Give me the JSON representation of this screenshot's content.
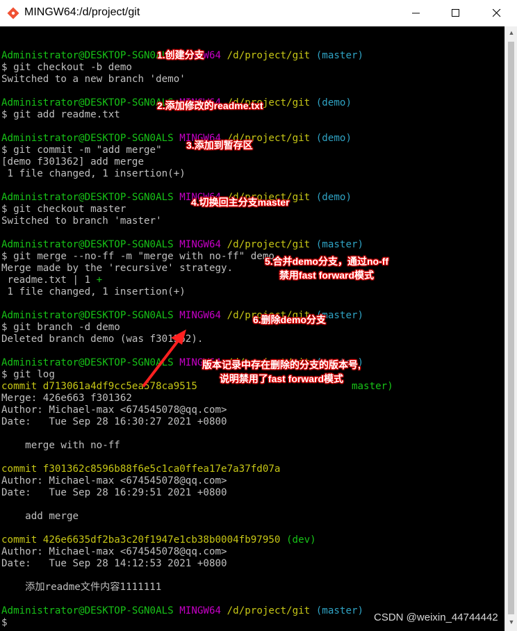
{
  "window": {
    "title": "MINGW64:/d/project/git"
  },
  "prompt": {
    "user_host": "Administrator@DESKTOP-SGN0ALS",
    "shell": "MINGW64",
    "path": "/d/project/git"
  },
  "lines": [
    {
      "segs": []
    },
    {
      "segs": [
        {
          "t": "Administrator@DESKTOP-SGN0ALS",
          "c": "user"
        },
        {
          "t": " "
        },
        {
          "t": "MINGW64",
          "c": "host"
        },
        {
          "t": " "
        },
        {
          "t": "/d/project/git",
          "c": "path"
        },
        {
          "t": " "
        },
        {
          "t": "(master)",
          "c": "branch"
        }
      ]
    },
    {
      "segs": [
        {
          "t": "$ git checkout -b demo"
        }
      ]
    },
    {
      "segs": [
        {
          "t": "Switched to a new branch 'demo'"
        }
      ]
    },
    {
      "segs": []
    },
    {
      "segs": [
        {
          "t": "Administrator@DESKTOP-SGN0ALS",
          "c": "user"
        },
        {
          "t": " "
        },
        {
          "t": "MINGW64",
          "c": "host"
        },
        {
          "t": " "
        },
        {
          "t": "/d/project/git",
          "c": "path"
        },
        {
          "t": " "
        },
        {
          "t": "(demo)",
          "c": "branch"
        }
      ]
    },
    {
      "segs": [
        {
          "t": "$ git add readme.txt"
        }
      ]
    },
    {
      "segs": []
    },
    {
      "segs": [
        {
          "t": "Administrator@DESKTOP-SGN0ALS",
          "c": "user"
        },
        {
          "t": " "
        },
        {
          "t": "MINGW64",
          "c": "host"
        },
        {
          "t": " "
        },
        {
          "t": "/d/project/git",
          "c": "path"
        },
        {
          "t": " "
        },
        {
          "t": "(demo)",
          "c": "branch"
        }
      ]
    },
    {
      "segs": [
        {
          "t": "$ git commit -m \"add merge\""
        }
      ]
    },
    {
      "segs": [
        {
          "t": "[demo f301362] add merge"
        }
      ]
    },
    {
      "segs": [
        {
          "t": " 1 file changed, 1 insertion(+)"
        }
      ]
    },
    {
      "segs": []
    },
    {
      "segs": [
        {
          "t": "Administrator@DESKTOP-SGN0ALS",
          "c": "user"
        },
        {
          "t": " "
        },
        {
          "t": "MINGW64",
          "c": "host"
        },
        {
          "t": " "
        },
        {
          "t": "/d/project/git",
          "c": "path"
        },
        {
          "t": " "
        },
        {
          "t": "(demo)",
          "c": "branch"
        }
      ]
    },
    {
      "segs": [
        {
          "t": "$ git checkout master"
        }
      ]
    },
    {
      "segs": [
        {
          "t": "Switched to branch 'master'"
        }
      ]
    },
    {
      "segs": []
    },
    {
      "segs": [
        {
          "t": "Administrator@DESKTOP-SGN0ALS",
          "c": "user"
        },
        {
          "t": " "
        },
        {
          "t": "MINGW64",
          "c": "host"
        },
        {
          "t": " "
        },
        {
          "t": "/d/project/git",
          "c": "path"
        },
        {
          "t": " "
        },
        {
          "t": "(master)",
          "c": "branch"
        }
      ]
    },
    {
      "segs": [
        {
          "t": "$ git merge --no-ff -m \"merge with no-ff\" demo"
        }
      ]
    },
    {
      "segs": [
        {
          "t": "Merge made by the 'recursive' strategy."
        }
      ]
    },
    {
      "segs": [
        {
          "t": " readme.txt | 1 "
        },
        {
          "t": "+",
          "c": "addsign"
        }
      ]
    },
    {
      "segs": [
        {
          "t": " 1 file changed, 1 insertion(+)"
        }
      ]
    },
    {
      "segs": []
    },
    {
      "segs": [
        {
          "t": "Administrator@DESKTOP-SGN0ALS",
          "c": "user"
        },
        {
          "t": " "
        },
        {
          "t": "MINGW64",
          "c": "host"
        },
        {
          "t": " "
        },
        {
          "t": "/d/project/git",
          "c": "path"
        },
        {
          "t": " "
        },
        {
          "t": "(master)",
          "c": "branch"
        }
      ]
    },
    {
      "segs": [
        {
          "t": "$ git branch -d demo"
        }
      ]
    },
    {
      "segs": [
        {
          "t": "Deleted branch demo (was f301362)."
        }
      ]
    },
    {
      "segs": []
    },
    {
      "segs": [
        {
          "t": "Administrator@DESKTOP-SGN0ALS",
          "c": "user"
        },
        {
          "t": " "
        },
        {
          "t": "MINGW64",
          "c": "host"
        },
        {
          "t": " "
        },
        {
          "t": "/d/project/git",
          "c": "path"
        },
        {
          "t": " "
        },
        {
          "t": "(master)",
          "c": "branch"
        }
      ]
    },
    {
      "segs": [
        {
          "t": "$ git log"
        }
      ]
    },
    {
      "segs": [
        {
          "t": "commit d713061a4df9cc5ea578ca9515",
          "c": "hash"
        },
        {
          "t": "                          "
        },
        {
          "t": "master)",
          "c": "devref"
        }
      ]
    },
    {
      "segs": [
        {
          "t": "Merge: 426e663 f301362"
        }
      ]
    },
    {
      "segs": [
        {
          "t": "Author: Michael-max <674545078@qq.com>"
        }
      ]
    },
    {
      "segs": [
        {
          "t": "Date:   Tue Sep 28 16:30:27 2021 +0800"
        }
      ]
    },
    {
      "segs": []
    },
    {
      "segs": [
        {
          "t": "    merge with no-ff"
        }
      ]
    },
    {
      "segs": []
    },
    {
      "segs": [
        {
          "t": "commit f301362c8596b88f6e5c1ca0ffea17e7a37fd07a",
          "c": "hash"
        }
      ]
    },
    {
      "segs": [
        {
          "t": "Author: Michael-max <674545078@qq.com>"
        }
      ]
    },
    {
      "segs": [
        {
          "t": "Date:   Tue Sep 28 16:29:51 2021 +0800"
        }
      ]
    },
    {
      "segs": []
    },
    {
      "segs": [
        {
          "t": "    add merge"
        }
      ]
    },
    {
      "segs": []
    },
    {
      "segs": [
        {
          "t": "commit 426e6635df2ba3c20f1947e1cb38b0004fb97950",
          "c": "hash"
        },
        {
          "t": " "
        },
        {
          "t": "(dev)",
          "c": "devref"
        }
      ]
    },
    {
      "segs": [
        {
          "t": "Author: Michael-max <674545078@qq.com>"
        }
      ]
    },
    {
      "segs": [
        {
          "t": "Date:   Tue Sep 28 14:12:53 2021 +0800"
        }
      ]
    },
    {
      "segs": []
    },
    {
      "segs": [
        {
          "t": "    添加readme文件内容1111111"
        }
      ]
    },
    {
      "segs": []
    },
    {
      "segs": [
        {
          "t": "Administrator@DESKTOP-SGN0ALS",
          "c": "user"
        },
        {
          "t": " "
        },
        {
          "t": "MINGW64",
          "c": "host"
        },
        {
          "t": " "
        },
        {
          "t": "/d/project/git",
          "c": "path"
        },
        {
          "t": " "
        },
        {
          "t": "(master)",
          "c": "branch"
        }
      ]
    },
    {
      "segs": [
        {
          "t": "$"
        }
      ]
    }
  ],
  "annotations": {
    "a1": "1.创建分支",
    "a2": "2.添加修改的readme.txt",
    "a3": "3.添加到暂存区",
    "a4": "4.切换回主分支master",
    "a5_line1": "5.合并demo分支，通过no-ff",
    "a5_line2": "禁用fast forward模式",
    "a6": "6.删除demo分支",
    "a7_line1": "版本记录中存在删除的分支的版本号,",
    "a7_line2": "说明禁用了fast forward模式"
  },
  "watermark": "CSDN @weixin_44744442",
  "colors": {
    "user": "#17c317",
    "host": "#c700c7",
    "path": "#c7c716",
    "branch": "#2fa3c4",
    "annotation_outline": "#e00000",
    "arrow": "#ff2020"
  }
}
